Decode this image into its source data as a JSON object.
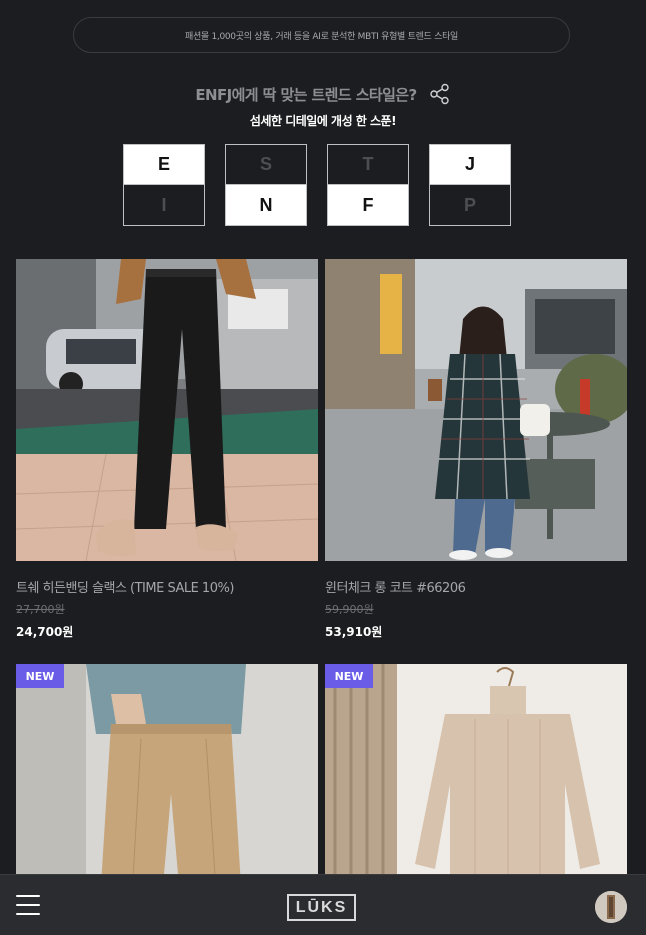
{
  "banner": {
    "text": "패션몰 1,000곳의 상품, 거래 등을 AI로 분석한 MBTI 유형별 트렌드 스타일"
  },
  "header": {
    "title": "ENFJ에게 딱 맞는 트렌드 스타일은?",
    "subtitle": "섬세한 디테일에 개성 한 스푼!",
    "share_icon": "share-icon"
  },
  "mbti": [
    {
      "top": "E",
      "bottom": "I",
      "selected": "top"
    },
    {
      "top": "S",
      "bottom": "N",
      "selected": "bottom"
    },
    {
      "top": "T",
      "bottom": "F",
      "selected": "bottom"
    },
    {
      "top": "J",
      "bottom": "P",
      "selected": "top"
    }
  ],
  "products": [
    {
      "name": "트쉐 히든밴딩 슬랙스 (TIME SALE 10%)",
      "original_price": "27,700원",
      "price": "24,700원",
      "badge": ""
    },
    {
      "name": "윈터체크 롱 코트 #66206",
      "original_price": "59,900원",
      "price": "53,910원",
      "badge": ""
    },
    {
      "name": "",
      "original_price": "",
      "price": "",
      "badge": "NEW"
    },
    {
      "name": "",
      "original_price": "",
      "price": "",
      "badge": "NEW"
    }
  ],
  "bottombar": {
    "menu_icon": "hamburger-menu-icon",
    "logo": "LŪKS",
    "avatar_icon": "profile-avatar"
  },
  "colors": {
    "background": "#1c1d20",
    "bar": "#2b2c30",
    "badge": "#6b5ce7"
  }
}
